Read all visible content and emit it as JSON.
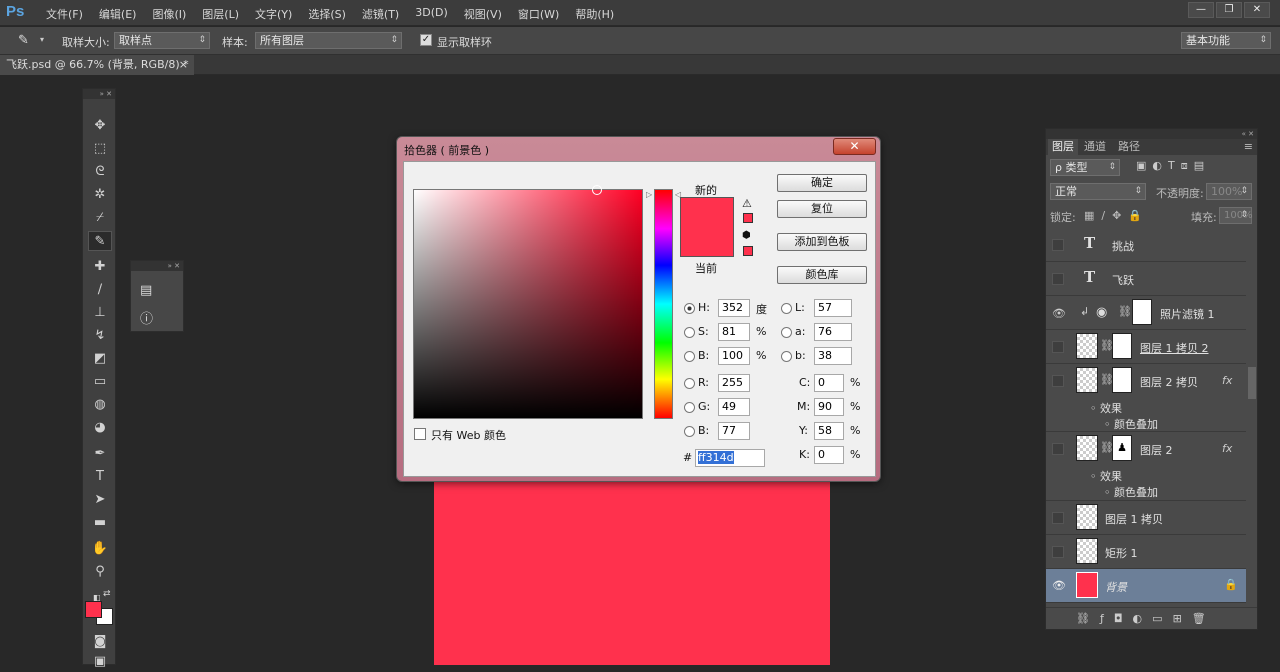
{
  "menubar": {
    "logo": "Ps",
    "items": [
      "文件(F)",
      "编辑(E)",
      "图像(I)",
      "图层(L)",
      "文字(Y)",
      "选择(S)",
      "滤镜(T)",
      "3D(D)",
      "视图(V)",
      "窗口(W)",
      "帮助(H)"
    ],
    "window_controls": [
      "—",
      "❐",
      "✕"
    ]
  },
  "options": {
    "sample_size_label": "取样大小:",
    "sample_size_value": "取样点",
    "sample_label": "样本:",
    "sample_value": "所有图层",
    "show_ring_label": "显示取样环",
    "workspace": "基本功能"
  },
  "document": {
    "tab": "飞跃.psd @ 66.7% (背景, RGB/8) *",
    "close": "×"
  },
  "canvas": {
    "fill": "#ff314d"
  },
  "color_picker": {
    "title": "拾色器 ( 前景色 )",
    "close": "✕",
    "new_label": "新的",
    "current_label": "当前",
    "new_color": "#ff314d",
    "current_color": "#ff314d",
    "buttons": {
      "ok": "确定",
      "reset": "复位",
      "add_swatch": "添加到色板",
      "libraries": "颜色库"
    },
    "web_only_label": "只有 Web 颜色",
    "fields": {
      "H": {
        "label": "H:",
        "value": "352",
        "unit": "度"
      },
      "S": {
        "label": "S:",
        "value": "81",
        "unit": "%"
      },
      "Bv": {
        "label": "B:",
        "value": "100",
        "unit": "%"
      },
      "R": {
        "label": "R:",
        "value": "255"
      },
      "G": {
        "label": "G:",
        "value": "49"
      },
      "Bb": {
        "label": "B:",
        "value": "77"
      },
      "L": {
        "label": "L:",
        "value": "57"
      },
      "a": {
        "label": "a:",
        "value": "76"
      },
      "b": {
        "label": "b:",
        "value": "38"
      },
      "C": {
        "label": "C:",
        "value": "0",
        "unit": "%"
      },
      "M": {
        "label": "M:",
        "value": "90",
        "unit": "%"
      },
      "Y": {
        "label": "Y:",
        "value": "58",
        "unit": "%"
      },
      "K": {
        "label": "K:",
        "value": "0",
        "unit": "%"
      }
    },
    "hex_label": "#",
    "hex_value": "ff314d"
  },
  "layers_panel": {
    "tabs": [
      "图层",
      "通道",
      "路径"
    ],
    "filter_kind": "ρ 类型",
    "blend_mode": "正常",
    "opacity_label": "不透明度:",
    "opacity_value": "100%",
    "lock_label": "锁定:",
    "fill_label": "填充:",
    "fill_value": "100%",
    "layers": [
      {
        "name": "挑战",
        "type": "text"
      },
      {
        "name": "飞跃",
        "type": "text"
      },
      {
        "name": "照片滤镜 1",
        "type": "adjustment"
      },
      {
        "name": "图层 1 拷贝 2",
        "type": "pixel"
      },
      {
        "name": "图层 2 拷贝",
        "type": "pixel",
        "fx": "fx",
        "effects_label": "效果",
        "effect": "颜色叠加"
      },
      {
        "name": "图层 2",
        "type": "pixel",
        "fx": "fx",
        "effects_label": "效果",
        "effect": "颜色叠加"
      },
      {
        "name": "图层 1 拷贝",
        "type": "pixel"
      },
      {
        "name": "矩形 1",
        "type": "shape"
      },
      {
        "name": "背景",
        "type": "background"
      }
    ],
    "text_icon": "T",
    "bottom_icons": [
      "link-icon",
      "fx-icon",
      "mask-icon",
      "adjustment-icon",
      "folder-icon",
      "new-layer-icon",
      "trash-icon"
    ]
  }
}
